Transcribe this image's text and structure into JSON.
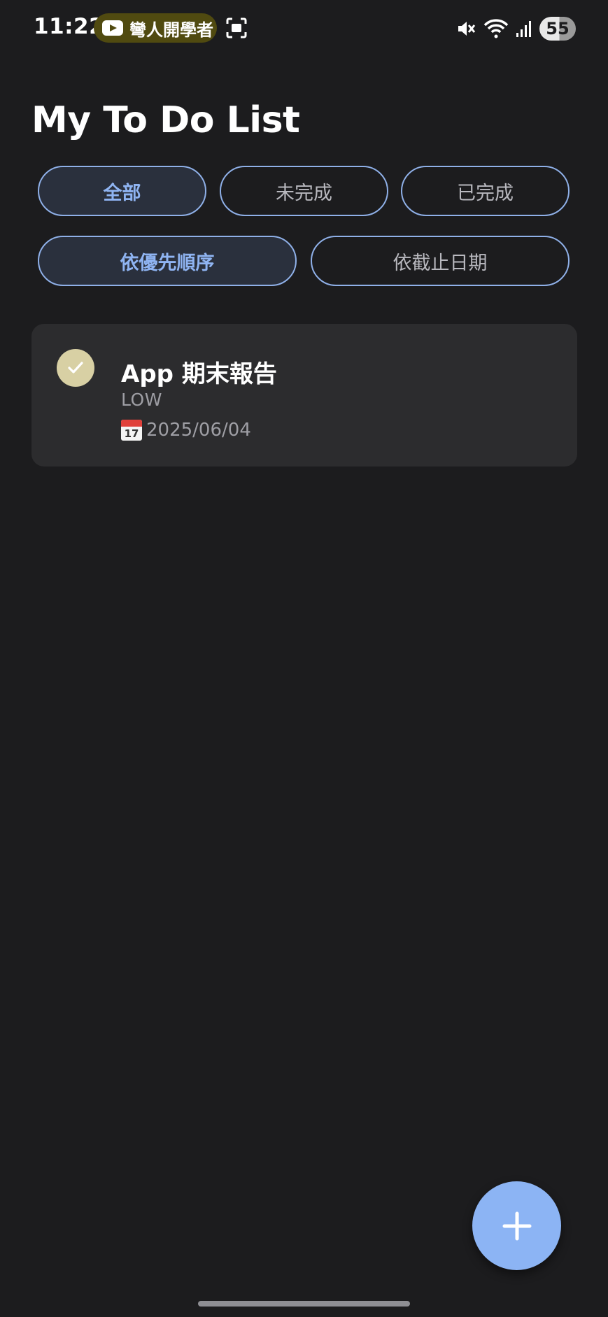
{
  "status_bar": {
    "time": "11:22",
    "notification_text": "彎人開學者",
    "notification_icon": "youtube-icon",
    "battery": "55"
  },
  "title": "My To Do List",
  "filters": {
    "status": [
      {
        "label": "全部",
        "selected": true
      },
      {
        "label": "未完成",
        "selected": false
      },
      {
        "label": "已完成",
        "selected": false
      }
    ],
    "sort": [
      {
        "label": "依優先順序",
        "selected": true
      },
      {
        "label": "依截止日期",
        "selected": false
      }
    ]
  },
  "tasks": [
    {
      "title": "App 期末報告",
      "priority": "LOW",
      "date_icon": "17",
      "date": "2025/06/04",
      "completed": true
    }
  ],
  "fab": {
    "icon": "plus-icon"
  },
  "colors": {
    "background": "#1c1c1e",
    "card": "#2c2c2e",
    "accent": "#8cb4f4",
    "chip_border": "#8fb0e8",
    "check": "#d8d0a4"
  }
}
